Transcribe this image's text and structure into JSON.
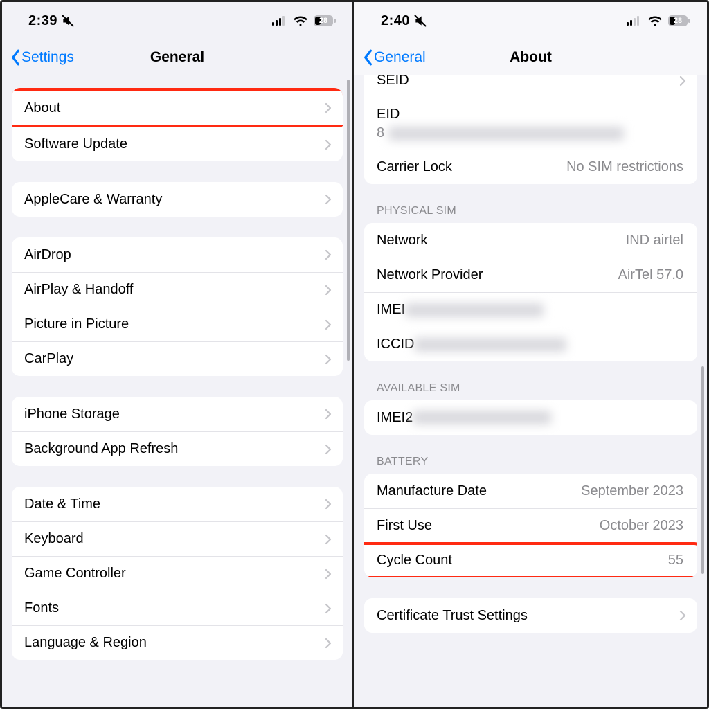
{
  "left": {
    "status": {
      "time": "2:39",
      "battery_pct": "28"
    },
    "nav": {
      "back_label": "Settings",
      "title": "General"
    },
    "groups": [
      {
        "rows": [
          {
            "label": "About",
            "highlighted": true
          },
          {
            "label": "Software Update"
          }
        ]
      },
      {
        "rows": [
          {
            "label": "AppleCare & Warranty"
          }
        ]
      },
      {
        "rows": [
          {
            "label": "AirDrop"
          },
          {
            "label": "AirPlay & Handoff"
          },
          {
            "label": "Picture in Picture"
          },
          {
            "label": "CarPlay"
          }
        ]
      },
      {
        "rows": [
          {
            "label": "iPhone Storage"
          },
          {
            "label": "Background App Refresh"
          }
        ]
      },
      {
        "rows": [
          {
            "label": "Date & Time"
          },
          {
            "label": "Keyboard"
          },
          {
            "label": "Game Controller"
          },
          {
            "label": "Fonts"
          },
          {
            "label": "Language & Region"
          }
        ]
      }
    ]
  },
  "right": {
    "status": {
      "time": "2:40",
      "battery_pct": "28"
    },
    "nav": {
      "back_label": "General",
      "title": "About"
    },
    "top_rows": {
      "seid": "SEID",
      "eid": "EID",
      "eid_prefix": "8",
      "carrier_lock": "Carrier Lock",
      "carrier_lock_value": "No SIM restrictions"
    },
    "physical_sim": {
      "header": "PHYSICAL SIM",
      "network": "Network",
      "network_value": "IND airtel",
      "provider": "Network Provider",
      "provider_value": "AirTel 57.0",
      "imei": "IMEI",
      "iccid": "ICCID"
    },
    "available_sim": {
      "header": "AVAILABLE SIM",
      "imei2": "IMEI2"
    },
    "battery": {
      "header": "BATTERY",
      "manufacture": "Manufacture Date",
      "manufacture_value": "September 2023",
      "first_use": "First Use",
      "first_use_value": "October 2023",
      "cycle_count": "Cycle Count",
      "cycle_count_value": "55"
    },
    "cert_row": "Certificate Trust Settings"
  }
}
